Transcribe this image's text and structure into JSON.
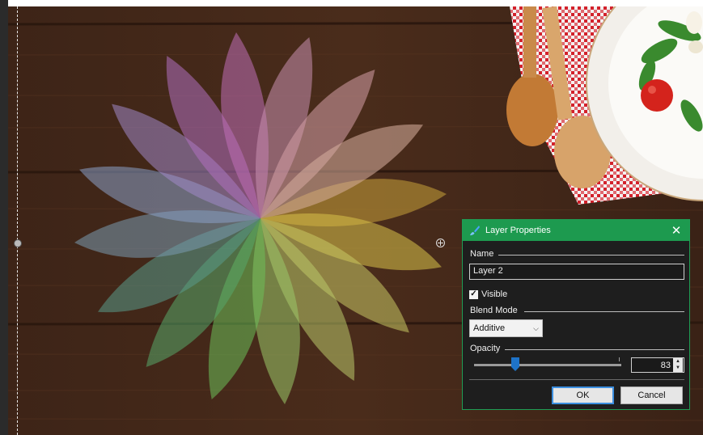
{
  "dialog": {
    "title": "Layer Properties",
    "close_glyph": "✕",
    "name_label": "Name",
    "name_value": "Layer 2",
    "visible_label": "Visible",
    "visible_checked": true,
    "blend_label": "Blend Mode",
    "blend_value": "Additive",
    "opacity_label": "Opacity",
    "opacity_value": "83",
    "opacity_fraction": 0.28,
    "ok_label": "OK",
    "cancel_label": "Cancel"
  },
  "icons": {
    "title_icon": "paintbrush-icon",
    "resize_handle": "crosshair-handle-icon"
  },
  "colors": {
    "accent": "#1d9a4f",
    "slider_thumb": "#1e73c8",
    "dialog_bg": "#1e1e1e"
  }
}
